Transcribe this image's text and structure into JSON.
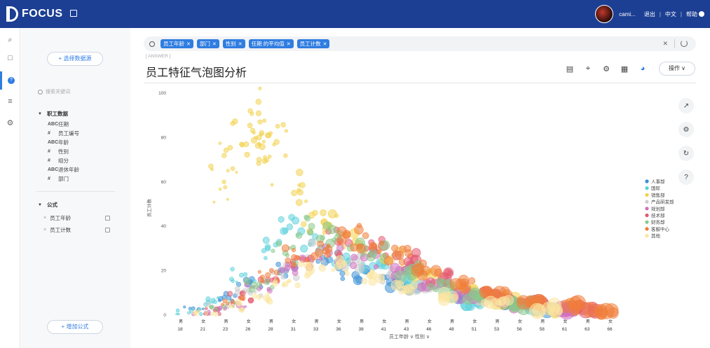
{
  "app": {
    "logo": "FOCUS",
    "user": "cami...",
    "links": [
      "退出",
      "中文",
      "帮助"
    ]
  },
  "sidebar": {
    "source_button": "+ 选择数据源",
    "search_placeholder": "搜索关键词",
    "table_group": "职工数据",
    "fields": [
      {
        "icon": "ABC",
        "label": "任期"
      },
      {
        "icon": "#",
        "label": "员工编号"
      },
      {
        "icon": "ABC",
        "label": "年龄"
      },
      {
        "icon": "#",
        "label": "性别"
      },
      {
        "icon": "#",
        "label": "组分"
      },
      {
        "icon": "ABC",
        "label": "退休年龄"
      },
      {
        "icon": "#",
        "label": "部门"
      }
    ],
    "formula_group": "公式",
    "formulas": [
      "员工年龄",
      "员工计数"
    ],
    "add_formula": "+ 增加公式"
  },
  "query": {
    "tokens": [
      "员工年龄",
      "部门",
      "性别",
      "任期 的平均值",
      "员工计数"
    ]
  },
  "main": {
    "answer_tag": "[ ANSWER ]",
    "title": "员工特征气泡图分析",
    "ops_button": "操作 ∨",
    "tools": [
      "comment-icon",
      "pin-icon",
      "gear-icon",
      "table-icon",
      "pie-chart-icon"
    ],
    "right_tools": [
      "axis-icon",
      "gear-icon",
      "refresh-icon",
      "help-icon"
    ]
  },
  "colors": {
    "header": "#1c3f94",
    "accent": "#2f7de1",
    "series": [
      "#3a8fd6",
      "#5cd1dc",
      "#f2d24e",
      "#cccccc",
      "#d06fc0",
      "#e35a70",
      "#8bc88a",
      "#f07d3a",
      "#fbe6a0"
    ]
  },
  "chart_data": {
    "type": "scatter",
    "title": "",
    "xlabel": "员工年龄 ∨  性别 ∨",
    "ylabel": "员工计数",
    "ylim": [
      0,
      100
    ],
    "yticks": [
      0,
      20,
      40,
      60,
      80,
      100
    ],
    "x_ages": [
      "18",
      "21",
      "23",
      "26",
      "28",
      "31",
      "33",
      "36",
      "38",
      "41",
      "43",
      "46",
      "48",
      "51",
      "53",
      "56",
      "58",
      "61",
      "63",
      "66"
    ],
    "x_genders": [
      "男",
      "女",
      "男",
      "女",
      "男",
      "女",
      "男",
      "女",
      "男",
      "女",
      "男",
      "女",
      "男",
      "女",
      "男",
      "女",
      "男",
      "女",
      "男",
      "女"
    ],
    "legend": [
      "人事部",
      "国际",
      "销售部",
      "产品研发部",
      "规划部",
      "技术部",
      "财务部",
      "客服中心",
      "其他"
    ],
    "legend_placement": "right",
    "series": [
      {
        "name": "人事部",
        "points": [
          [
            20,
            2
          ],
          [
            23,
            8
          ],
          [
            26,
            15
          ],
          [
            30,
            20
          ],
          [
            35,
            25
          ],
          [
            38,
            18
          ],
          [
            42,
            15
          ],
          [
            45,
            12
          ],
          [
            50,
            8
          ],
          [
            55,
            5
          ],
          [
            60,
            3
          ]
        ]
      },
      {
        "name": "国际",
        "points": [
          [
            19,
            1
          ],
          [
            22,
            6
          ],
          [
            25,
            18
          ],
          [
            28,
            30
          ],
          [
            30,
            38
          ],
          [
            33,
            33
          ],
          [
            36,
            28
          ],
          [
            40,
            22
          ],
          [
            44,
            16
          ],
          [
            48,
            10
          ],
          [
            52,
            6
          ],
          [
            58,
            3
          ]
        ]
      },
      {
        "name": "销售部",
        "points": [
          [
            23,
            60
          ],
          [
            24,
            66
          ],
          [
            25,
            77
          ],
          [
            26,
            92
          ],
          [
            27,
            80
          ],
          [
            28,
            81
          ],
          [
            29,
            78
          ],
          [
            27,
            70
          ],
          [
            31,
            55
          ],
          [
            33,
            45
          ],
          [
            35,
            40
          ],
          [
            38,
            33
          ],
          [
            42,
            25
          ],
          [
            46,
            18
          ],
          [
            50,
            12
          ],
          [
            55,
            7
          ],
          [
            62,
            3
          ]
        ]
      },
      {
        "name": "产品研发部",
        "points": [
          [
            22,
            3
          ],
          [
            26,
            10
          ],
          [
            30,
            20
          ],
          [
            34,
            28
          ],
          [
            38,
            25
          ],
          [
            42,
            18
          ],
          [
            46,
            12
          ],
          [
            52,
            7
          ],
          [
            58,
            4
          ]
        ]
      },
      {
        "name": "规划部",
        "points": [
          [
            21,
            1
          ],
          [
            24,
            5
          ],
          [
            27,
            12
          ],
          [
            31,
            22
          ],
          [
            35,
            28
          ],
          [
            39,
            26
          ],
          [
            43,
            20
          ],
          [
            47,
            14
          ],
          [
            51,
            9
          ],
          [
            56,
            5
          ],
          [
            62,
            2
          ]
        ]
      },
      {
        "name": "技术部",
        "points": [
          [
            22,
            2
          ],
          [
            25,
            8
          ],
          [
            28,
            16
          ],
          [
            32,
            25
          ],
          [
            36,
            33
          ],
          [
            40,
            30
          ],
          [
            44,
            24
          ],
          [
            48,
            17
          ],
          [
            53,
            10
          ],
          [
            58,
            6
          ],
          [
            64,
            3
          ]
        ]
      },
      {
        "name": "财务部",
        "points": [
          [
            23,
            4
          ],
          [
            27,
            14
          ],
          [
            30,
            28
          ],
          [
            33,
            40
          ],
          [
            36,
            35
          ],
          [
            40,
            28
          ],
          [
            44,
            20
          ],
          [
            48,
            14
          ],
          [
            52,
            9
          ],
          [
            57,
            5
          ]
        ]
      },
      {
        "name": "客服中心",
        "points": [
          [
            24,
            6
          ],
          [
            28,
            18
          ],
          [
            31,
            26
          ],
          [
            34,
            32
          ],
          [
            37,
            36
          ],
          [
            40,
            31
          ],
          [
            43,
            27
          ],
          [
            46,
            20
          ],
          [
            50,
            14
          ],
          [
            54,
            9
          ],
          [
            58,
            6
          ],
          [
            62,
            4
          ],
          [
            66,
            2
          ]
        ]
      },
      {
        "name": "其他",
        "points": [
          [
            21,
            1
          ],
          [
            24,
            4
          ],
          [
            27,
            8
          ],
          [
            30,
            14
          ],
          [
            33,
            20
          ],
          [
            36,
            22
          ],
          [
            40,
            18
          ],
          [
            44,
            12
          ],
          [
            48,
            8
          ],
          [
            54,
            5
          ],
          [
            60,
            3
          ]
        ]
      }
    ]
  }
}
